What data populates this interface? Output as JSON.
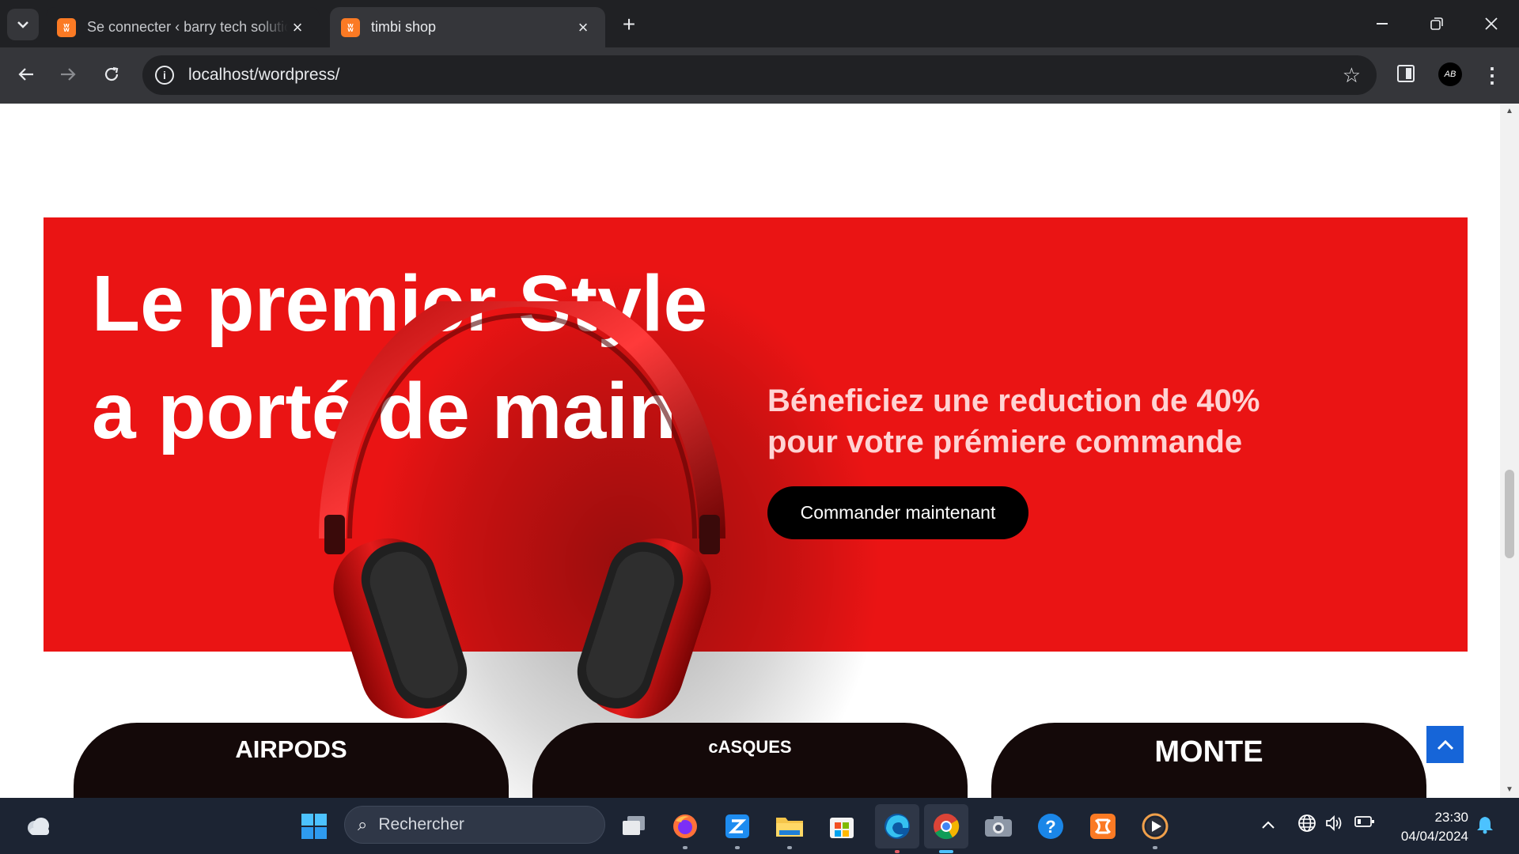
{
  "browser": {
    "tabs": [
      {
        "title": "Se connecter ‹ barry tech solutions",
        "active": false
      },
      {
        "title": "timbi shop",
        "active": true
      }
    ],
    "url": "localhost/wordpress/",
    "avatar_initials": "AB",
    "favicon_glyph": "ʬ"
  },
  "hero": {
    "title_line1": "Le premier Style",
    "title_line2": "a porté de main",
    "subtitle_line1": "Béneficiez une reduction de 40%",
    "subtitle_line2": "pour votre prémiere commande",
    "cta_label": "Commander maintenant",
    "background_color": "#ea1414"
  },
  "categories": [
    {
      "label": "AIRPODS"
    },
    {
      "label": "cASQUES"
    },
    {
      "label": "MONTE"
    }
  ],
  "taskbar": {
    "search_placeholder": "Rechercher",
    "time": "23:30",
    "date": "04/04/2024"
  }
}
